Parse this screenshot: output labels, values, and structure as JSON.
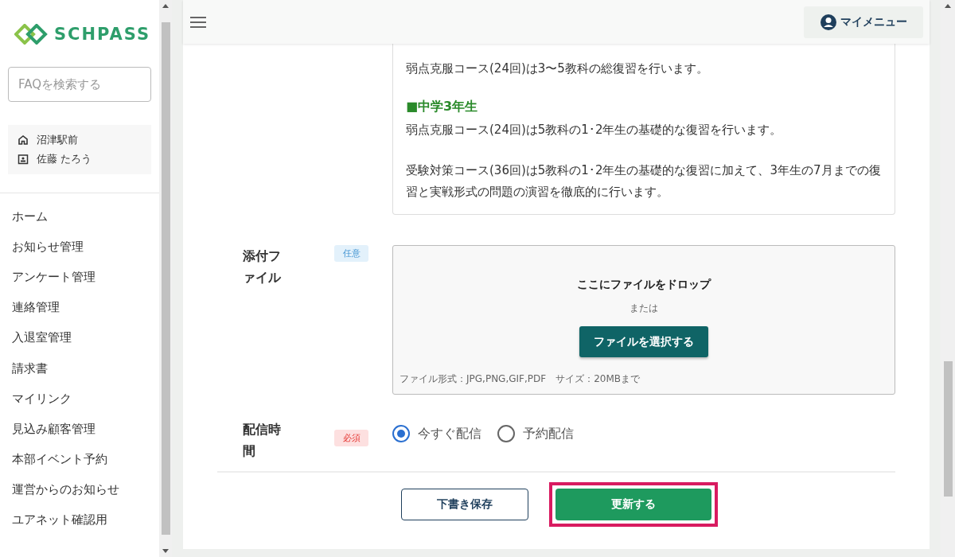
{
  "sidebar": {
    "logo": "SCHPASS",
    "search": {
      "placeholder": "FAQを検索する"
    },
    "user": {
      "school": "沼津駅前",
      "name": "佐藤 たろう"
    },
    "items": [
      {
        "label": "ホーム"
      },
      {
        "label": "お知らせ管理"
      },
      {
        "label": "アンケート管理"
      },
      {
        "label": "連絡管理"
      },
      {
        "label": "入退室管理"
      },
      {
        "label": "請求書"
      },
      {
        "label": "マイリンク"
      },
      {
        "label": "見込み顧客管理"
      },
      {
        "label": "本部イベント予約"
      },
      {
        "label": "運営からのお知らせ"
      },
      {
        "label": "ユアネット確認用"
      }
    ]
  },
  "header": {
    "my_menu": "マイメニュー"
  },
  "body_text": {
    "blocks": [
      {
        "lines": [
          {
            "kind": "text",
            "text": "弱点克服コース(24回)は3〜5教科の総復習を行います。"
          }
        ]
      },
      {
        "lines": [
          {
            "kind": "heading",
            "text": "■中学3年生"
          },
          {
            "kind": "text",
            "text": "弱点克服コース(24回)は5教科の1･2年生の基礎的な復習を行います。"
          }
        ]
      },
      {
        "lines": [
          {
            "kind": "text",
            "text": "受験対策コース(36回)は5教科の1･2年生の基礎的な復習に加えて、3年生の7月までの復習と実戦形式の問題の演習を徹底的に行います。"
          }
        ]
      }
    ]
  },
  "attachment": {
    "label": "添付ファイル",
    "badge": {
      "kind": "optional",
      "text": "任意"
    },
    "drop_text": "ここにファイルをドロップ",
    "or_text": "または",
    "select_button": "ファイルを選択する",
    "hint": "ファイル形式：JPG,PNG,GIF,PDF　サイズ：20MBまで"
  },
  "delivery": {
    "label": "配信時間",
    "badge": {
      "kind": "required",
      "text": "必須"
    },
    "options": [
      {
        "label": "今すぐ配信",
        "selected": true
      },
      {
        "label": "予約配信",
        "selected": false
      }
    ]
  },
  "buttons": [
    {
      "kind": "secondary",
      "label": "下書き保存",
      "highlighted": false
    },
    {
      "kind": "primary",
      "label": "更新する",
      "highlighted": true
    }
  ]
}
